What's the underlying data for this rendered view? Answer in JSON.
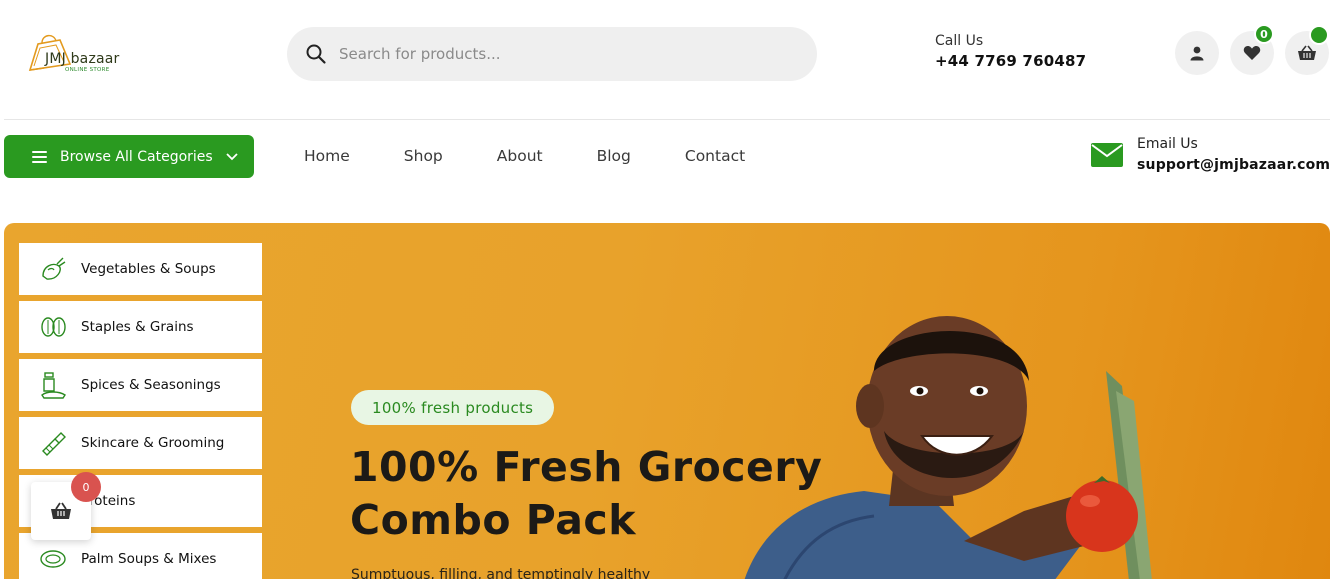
{
  "header": {
    "logo": {
      "name": "JMJ bazaar",
      "tagline": "ONLINE STORE"
    },
    "search": {
      "placeholder": "Search for products..."
    },
    "call": {
      "label": "Call Us",
      "number": "+44 7769 760487"
    },
    "icons": [
      {
        "name": "account-icon"
      },
      {
        "name": "wishlist-icon",
        "badge": "0"
      },
      {
        "name": "cart-icon",
        "badge": ""
      }
    ]
  },
  "nav": {
    "browse_label": "Browse All Categories",
    "links": [
      "Home",
      "Shop",
      "About",
      "Blog",
      "Contact"
    ],
    "email": {
      "label": "Email Us",
      "address": "support@jmjbazaar.com"
    }
  },
  "categories": [
    {
      "label": "Vegetables & Soups",
      "icon": "vegetables-icon"
    },
    {
      "label": "Staples & Grains",
      "icon": "grains-icon"
    },
    {
      "label": "Spices & Seasonings",
      "icon": "spices-icon"
    },
    {
      "label": "Skincare & Grooming",
      "icon": "skincare-icon"
    },
    {
      "label": "Proteins",
      "icon": "proteins-icon"
    },
    {
      "label": "Palm Soups & Mixes",
      "icon": "palm-soup-icon"
    }
  ],
  "hero": {
    "pill": "100% fresh products",
    "title_line1": "100% Fresh Grocery",
    "title_line2": "Combo Pack",
    "subtitle": "Sumptuous, filling, and temptingly healthy"
  },
  "floating_cart": {
    "count": "0"
  },
  "colors": {
    "brand_green": "#2a9a20",
    "hero_orange": "#e8a22b",
    "badge_red": "#d9534f"
  }
}
